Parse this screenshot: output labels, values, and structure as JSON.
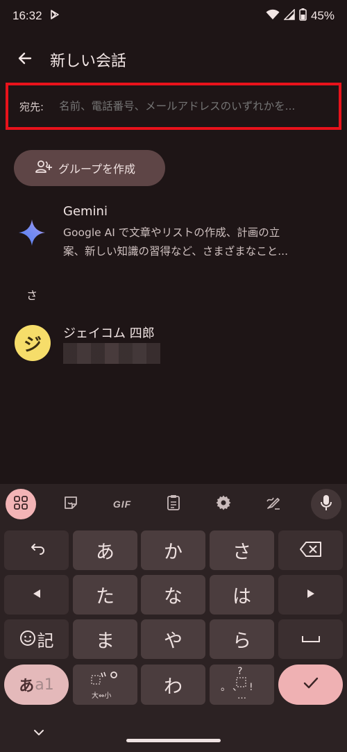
{
  "status_bar": {
    "time": "16:32",
    "battery": "45%",
    "icons": [
      "play-store-icon",
      "wifi-icon",
      "signal-icon",
      "battery-icon"
    ]
  },
  "app_bar": {
    "title": "新しい会話"
  },
  "to_field": {
    "label": "宛先:",
    "placeholder": "名前、電話番号、メールアドレスのいずれかを..."
  },
  "group_button": {
    "label": "グループを作成"
  },
  "gemini": {
    "name": "Gemini",
    "desc_line1": "Google AI で文章やリストの作成、計画の立",
    "desc_line2": "案、新しい知識の習得など、さまざまなこと..."
  },
  "section": {
    "header": "さ"
  },
  "contact": {
    "initial": "ジ",
    "name": "ジェイコム 四郎"
  },
  "keyboard": {
    "toolbar": {
      "gif_label": "GIF"
    },
    "keys": {
      "a": "あ",
      "ka": "か",
      "sa": "さ",
      "ta": "た",
      "na": "な",
      "ha": "は",
      "ma": "ま",
      "ya": "や",
      "ra": "ら",
      "wa": "わ",
      "emoji_label": "記",
      "mode_a": "あ",
      "mode_1": "a1",
      "dakuten_sub": "大⇔小",
      "punct_top": "?",
      "punct_mid": "。、!",
      "punct_bottom": "…"
    }
  },
  "colors": {
    "background": "#1e1516",
    "highlight_border": "#e8121b",
    "accent_pink": "#efb1b3",
    "avatar_yellow": "#f6dd6a"
  }
}
